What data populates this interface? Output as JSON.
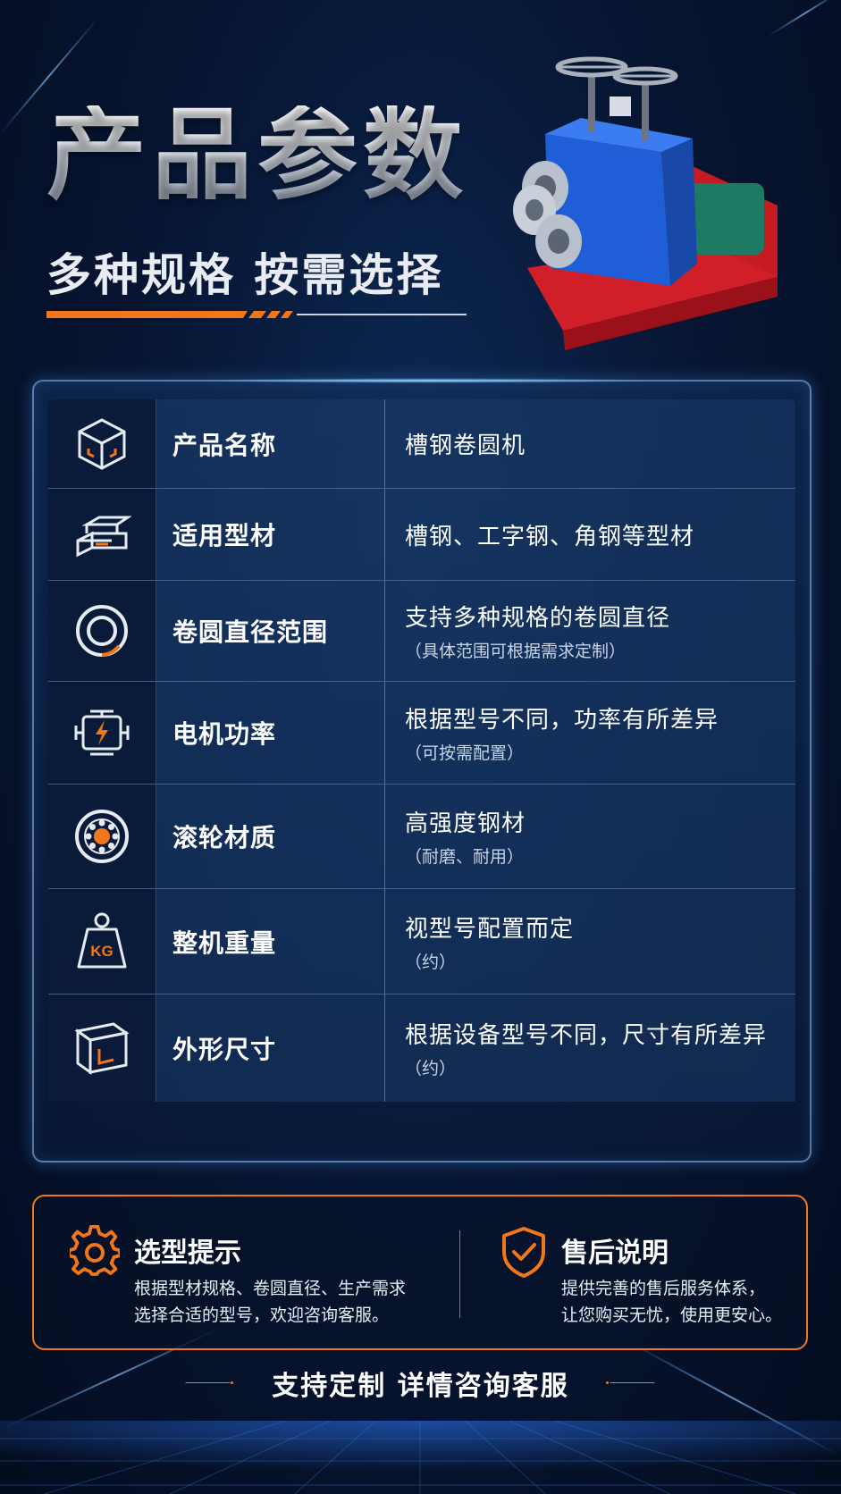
{
  "header": {
    "title": "产品参数",
    "subtitle": "多种规格 按需选择"
  },
  "accent_color": "#f0771a",
  "specs": [
    {
      "icon": "box-icon",
      "label": "产品名称",
      "value": "槽钢卷圆机",
      "note": ""
    },
    {
      "icon": "steel-bars-icon",
      "label": "适用型材",
      "value": "槽钢、工字钢、角钢等型材",
      "note": ""
    },
    {
      "icon": "ring-icon",
      "label": "卷圆直径范围",
      "value": "支持多种规格的卷圆直径",
      "note": "（具体范围可根据需求定制）"
    },
    {
      "icon": "motor-icon",
      "label": "电机功率",
      "value": "根据型号不同，功率有所差异",
      "note": "（可按需配置）"
    },
    {
      "icon": "bearing-icon",
      "label": "滚轮材质",
      "value": "高强度钢材",
      "note": "（耐磨、耐用）"
    },
    {
      "icon": "weight-icon",
      "label": "整机重量",
      "value": "视型号配置而定",
      "note": "（约）",
      "icon_text": "KG"
    },
    {
      "icon": "dimension-cube-icon",
      "label": "外形尺寸",
      "value": "根据设备型号不同，尺寸有所差异",
      "note": "（约）"
    }
  ],
  "tips": {
    "selection": {
      "title": "选型提示",
      "line1": "根据型材规格、卷圆直径、生产需求",
      "line2": "选择合适的型号，欢迎咨询客服。"
    },
    "after_sales": {
      "title": "售后说明",
      "line1": "提供完善的售后服务体系，",
      "line2": "让您购买无忧，使用更安心。"
    }
  },
  "footer": {
    "text": "支持定制 详情咨询客服"
  }
}
